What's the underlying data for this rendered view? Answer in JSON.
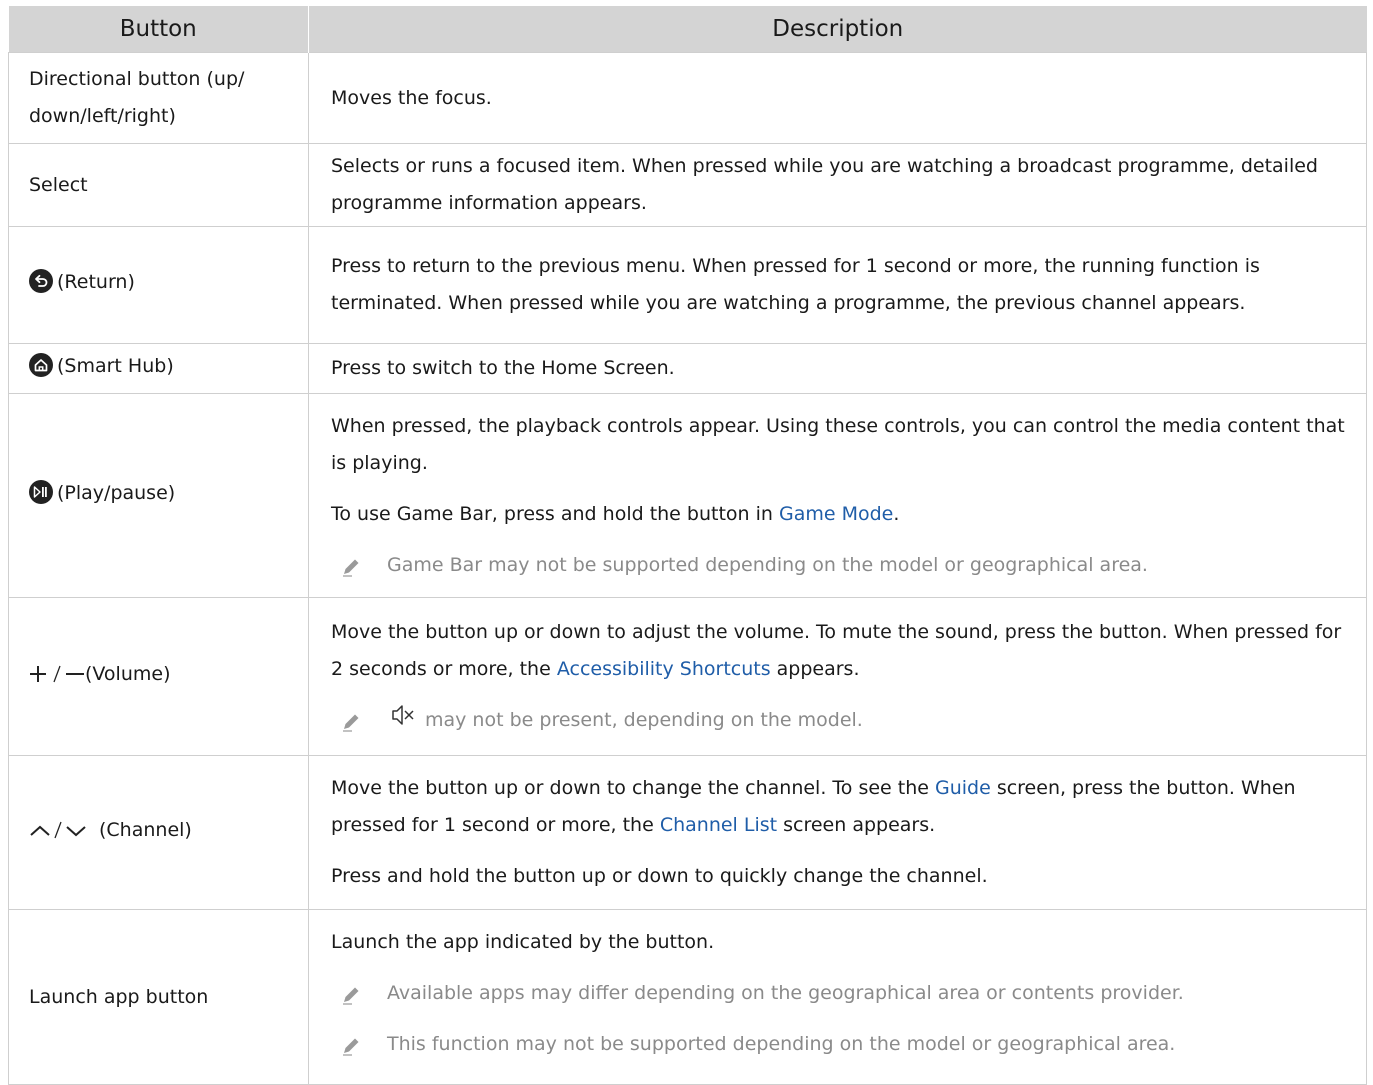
{
  "headers": {
    "button": "Button",
    "description": "Description"
  },
  "rows": {
    "directional": {
      "button": "Directional button (up/ down/left/right)",
      "desc": "Moves the focus."
    },
    "select": {
      "button": "Select",
      "desc": "Selects or runs a focused item. When pressed while you are watching a broadcast programme, detailed programme information appears."
    },
    "return": {
      "icon": "return-icon",
      "button": "(Return)",
      "desc": "Press to return to the previous menu. When pressed for 1 second or more, the running function is terminated. When pressed while you are watching a programme, the previous channel appears."
    },
    "smarthub": {
      "icon": "home-icon",
      "button": "(Smart Hub)",
      "desc": "Press to switch to the Home Screen."
    },
    "playpause": {
      "icon": "play-pause-icon",
      "button": "(Play/pause)",
      "desc1": "When pressed, the playback controls appear. Using these controls, you can control the media content that is playing.",
      "desc2_pre": "To use Game Bar, press and hold the button in ",
      "desc2_link": "Game Mode",
      "desc2_post": ".",
      "note": "Game Bar may not be supported depending on the model or geographical area."
    },
    "volume": {
      "icon": "plus-minus-icon",
      "button": "(Volume)",
      "desc_pre": "Move the button up or down to adjust the volume. To mute the sound, press the button. When pressed for 2 seconds or more, the ",
      "desc_link": "Accessibility Shortcuts",
      "desc_post": " appears.",
      "note": "may not be present, depending on the model."
    },
    "channel": {
      "icon": "up-down-chevron-icon",
      "button": "(Channel)",
      "desc_pre": "Move the button up or down to change the channel. To see the ",
      "desc_link1": "Guide",
      "desc_mid": " screen, press the button. When pressed for 1 second or more, the ",
      "desc_link2": "Channel List",
      "desc_post": " screen appears.",
      "desc2": "Press and hold the button up or down to quickly change the channel."
    },
    "launch": {
      "button": "Launch app button",
      "desc": "Launch the app indicated by the button.",
      "note1": "Available apps may differ depending on the geographical area or contents provider.",
      "note2": "This function may not be supported depending on the model or geographical area."
    }
  },
  "colors": {
    "link": "#1f5da8",
    "header_bg": "#d4d4d4",
    "note": "#8a8a8a"
  }
}
